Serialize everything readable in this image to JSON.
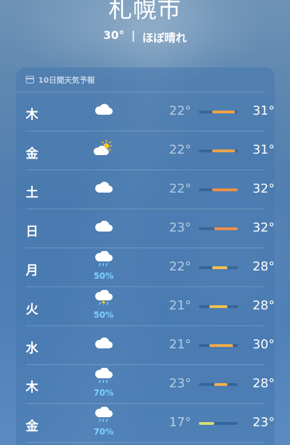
{
  "header": {
    "city": "札幌市",
    "temp": "30°",
    "separator": "|",
    "condition": "ほぼ晴れ"
  },
  "forecast": {
    "title": "10日間天気予報",
    "scale": {
      "min": 17,
      "max": 32
    },
    "days": [
      {
        "day": "木",
        "icon": "cloud-icon",
        "pop": "",
        "low": "22°",
        "high": "31°",
        "low_val": 22,
        "high_val": 31,
        "color": "#f0a24a"
      },
      {
        "day": "金",
        "icon": "partly-sunny-icon",
        "pop": "",
        "low": "22°",
        "high": "31°",
        "low_val": 22,
        "high_val": 31,
        "color": "#f0a24a"
      },
      {
        "day": "土",
        "icon": "cloud-icon",
        "pop": "",
        "low": "22°",
        "high": "32°",
        "low_val": 22,
        "high_val": 32,
        "color": "#ee8f48"
      },
      {
        "day": "日",
        "icon": "cloud-icon",
        "pop": "",
        "low": "23°",
        "high": "32°",
        "low_val": 23,
        "high_val": 32,
        "color": "#ee8f48"
      },
      {
        "day": "月",
        "icon": "cloud-rain-icon",
        "pop": "50%",
        "low": "22°",
        "high": "28°",
        "low_val": 22,
        "high_val": 28,
        "color": "#f6c04a"
      },
      {
        "day": "火",
        "icon": "thunderstorm-icon",
        "pop": "50%",
        "low": "21°",
        "high": "28°",
        "low_val": 21,
        "high_val": 28,
        "color": "#f6c04a"
      },
      {
        "day": "水",
        "icon": "cloud-icon",
        "pop": "",
        "low": "21°",
        "high": "30°",
        "low_val": 21,
        "high_val": 30,
        "color": "#f2aa48"
      },
      {
        "day": "木",
        "icon": "cloud-rain-icon",
        "pop": "70%",
        "low": "23°",
        "high": "28°",
        "low_val": 23,
        "high_val": 28,
        "color": "#f3b04a"
      },
      {
        "day": "金",
        "icon": "cloud-rain-icon",
        "pop": "70%",
        "low": "17°",
        "high": "23°",
        "low_val": 17,
        "high_val": 23,
        "color": "#d8dd7a"
      }
    ]
  }
}
